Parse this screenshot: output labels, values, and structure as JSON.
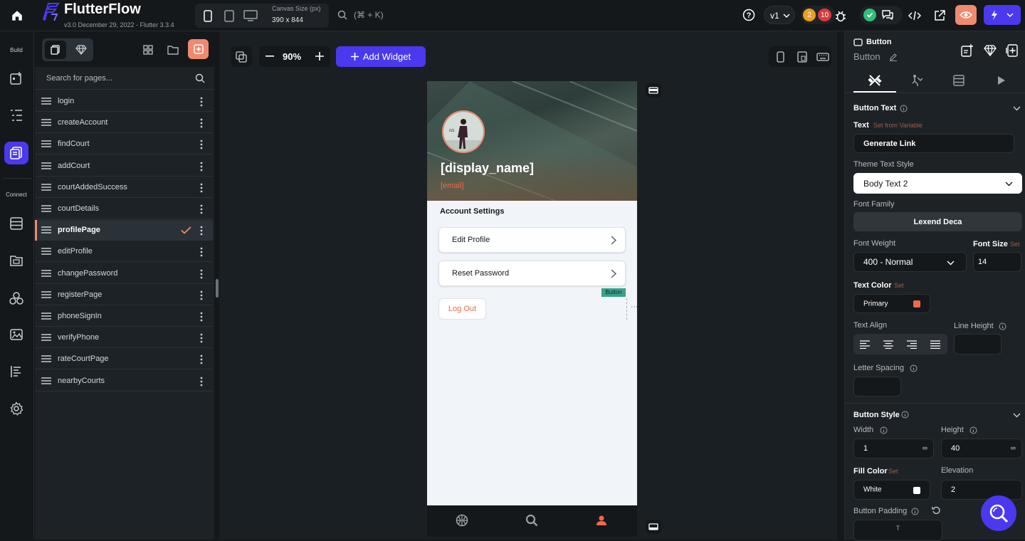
{
  "app": {
    "title": "FlutterFlow",
    "version": "v3.0 December 29, 2022 - Flutter 3.3.4"
  },
  "topbar": {
    "canvas_size_label": "Canvas Size (px)",
    "canvas_size_value": "390 x 844",
    "search_shortcut": "(⌘ + K)",
    "version_select": "v1",
    "badge_warnings": "2",
    "badge_errors": "10"
  },
  "rail": {
    "build_label": "Build",
    "connect_label": "Connect"
  },
  "pages_panel": {
    "search_placeholder": "Search for pages...",
    "pages": [
      {
        "label": "login"
      },
      {
        "label": "createAccount"
      },
      {
        "label": "findCourt"
      },
      {
        "label": "addCourt"
      },
      {
        "label": "courtAddedSuccess"
      },
      {
        "label": "courtDetails"
      },
      {
        "label": "profilePage",
        "active": true
      },
      {
        "label": "editProfile"
      },
      {
        "label": "changePassword"
      },
      {
        "label": "registerPage"
      },
      {
        "label": "phoneSignIn"
      },
      {
        "label": "verifyPhone"
      },
      {
        "label": "rateCourtPage"
      },
      {
        "label": "nearbyCourts"
      }
    ]
  },
  "canvas_toolbar": {
    "zoom": "90%",
    "add_widget": "Add Widget"
  },
  "phone": {
    "display_name": "[display_name]",
    "email": "[email]",
    "section_title": "Account Settings",
    "cards": [
      "Edit Profile",
      "Reset Password"
    ],
    "selected_tag": "Button",
    "logout": "Log Out"
  },
  "props": {
    "widget_type": "Button",
    "widget_name": "Button",
    "button_text_section": "Button Text",
    "text_label": "Text",
    "set_from_variable": "Set from Variable",
    "text_value": "Generate Link",
    "theme_text_style_label": "Theme Text Style",
    "theme_text_style_value": "Body Text 2",
    "font_family_label": "Font Family",
    "font_family_value": "Lexend Deca",
    "font_weight_label": "Font Weight",
    "font_weight_value": "400 - Normal",
    "font_size_label": "Font Size",
    "font_size_set": "Set",
    "font_size_value": "14",
    "text_color_label": "Text Color",
    "text_color_set": "Set",
    "text_color_value": "Primary",
    "text_color_swatch": "#ef6a4a",
    "text_align_label": "Text Align",
    "line_height_label": "Line Height",
    "letter_spacing_label": "Letter Spacing",
    "button_style_section": "Button Style",
    "width_label": "Width",
    "width_value": "1",
    "height_label": "Height",
    "height_value": "40",
    "infinity": "∞",
    "fill_color_label": "Fill Color",
    "fill_color_set": "Set",
    "fill_color_value": "White",
    "elevation_label": "Elevation",
    "elevation_value": "2",
    "button_padding_label": "Button Padding",
    "padding_top": "T"
  },
  "colors": {
    "accent": "#4b39ef",
    "primary": "#ef6a4a",
    "bg": "#14181b",
    "panel": "#1d2226"
  }
}
